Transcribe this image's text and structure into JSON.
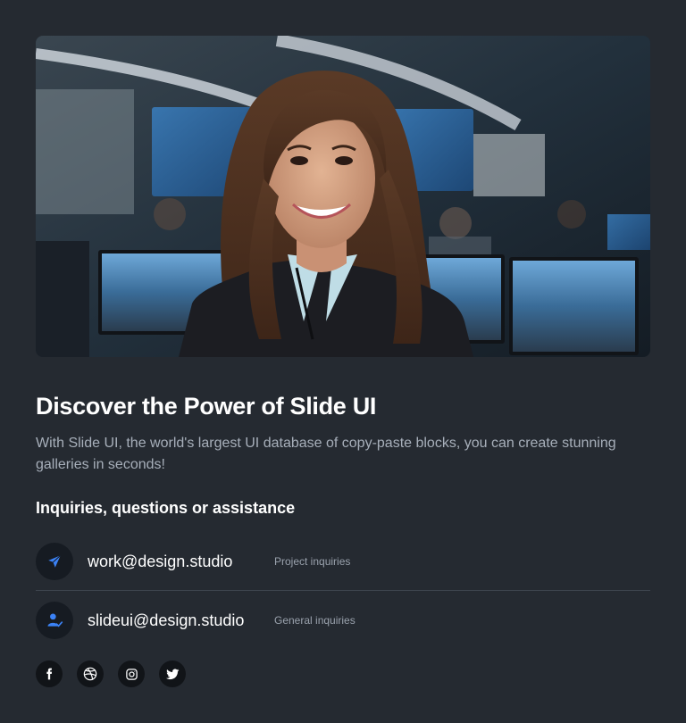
{
  "hero": {
    "image": "portrait-photo"
  },
  "title": "Discover the Power of Slide UI",
  "description": "With Slide UI, the world's largest UI database of copy-paste blocks, you can create stunning galleries in seconds!",
  "inquiries": {
    "heading": "Inquiries, questions or assistance",
    "contacts": [
      {
        "icon": "paper-plane-icon",
        "email": "work@design.studio",
        "note": "Project inquiries"
      },
      {
        "icon": "user-check-icon",
        "email": "slideui@design.studio",
        "note": "General inquiries"
      }
    ]
  },
  "socials": [
    {
      "icon": "facebook-icon"
    },
    {
      "icon": "dribbble-icon"
    },
    {
      "icon": "instagram-icon"
    },
    {
      "icon": "twitter-icon"
    }
  ],
  "colors": {
    "background": "#252a31",
    "accent": "#3b82f6",
    "muted_text": "#a7afba",
    "icon_bg": "#161b22"
  }
}
